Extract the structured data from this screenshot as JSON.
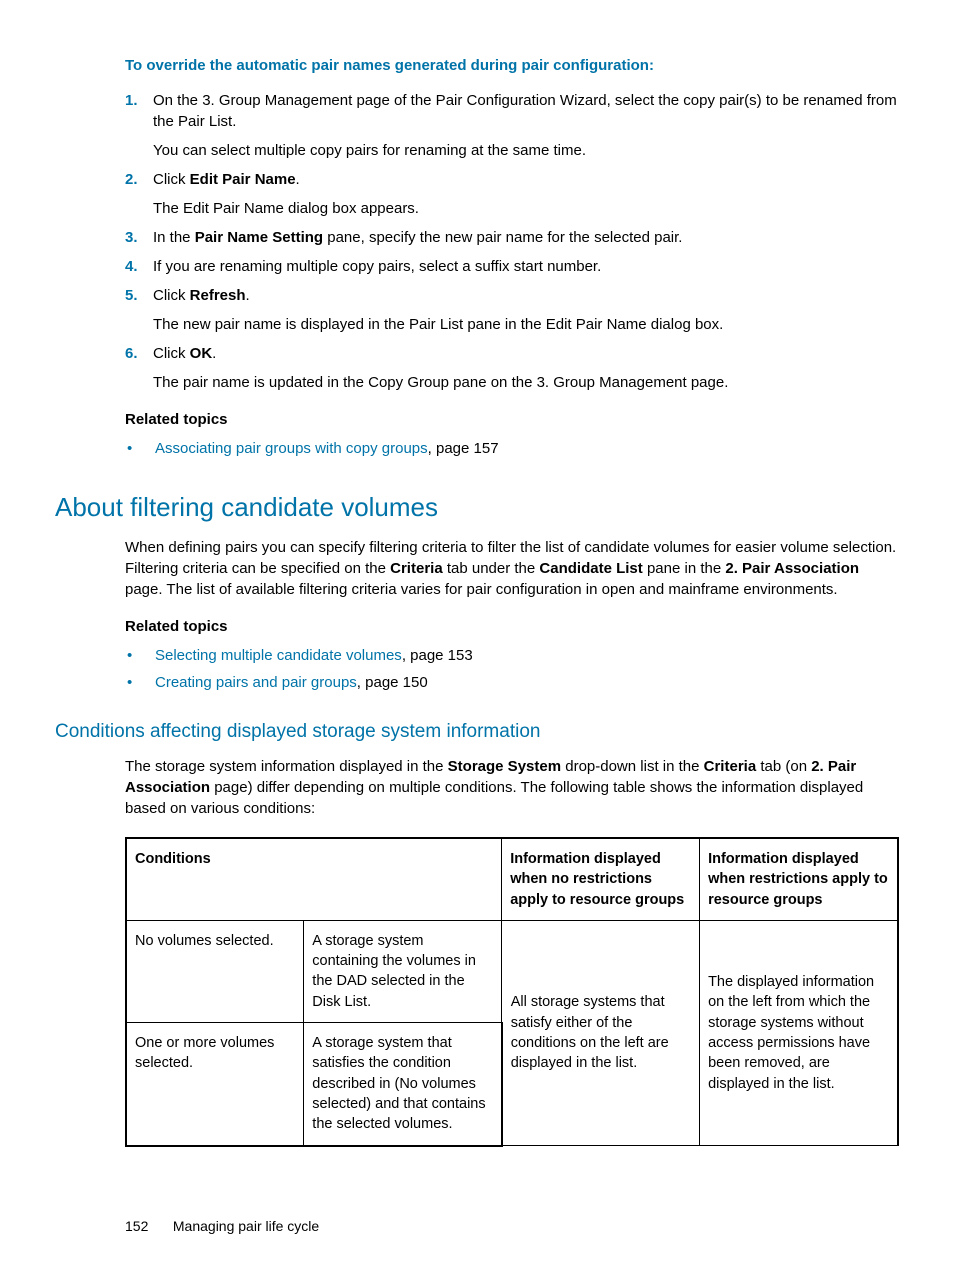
{
  "override": {
    "heading": "To override the automatic pair names generated during pair configuration:",
    "steps": [
      {
        "num": "1.",
        "p1": "On the 3. Group Management page of the Pair Configuration Wizard, select the copy pair(s) to be renamed from the Pair List.",
        "p2": "You can select multiple copy pairs for renaming at the same time."
      },
      {
        "num": "2.",
        "p1_pre": "Click ",
        "p1_b": "Edit Pair Name",
        "p1_post": ".",
        "p2": "The Edit Pair Name dialog box appears."
      },
      {
        "num": "3.",
        "p1_pre": "In the ",
        "p1_b": "Pair Name Setting",
        "p1_post": " pane, specify the new pair name  for the selected pair."
      },
      {
        "num": "4.",
        "p1": "If you are renaming multiple copy pairs, select a suffix start number."
      },
      {
        "num": "5.",
        "p1_pre": "Click ",
        "p1_b": "Refresh",
        "p1_post": ".",
        "p2": "The new pair name is displayed in the Pair List pane in the Edit Pair Name dialog box."
      },
      {
        "num": "6.",
        "p1_pre": "Click ",
        "p1_b": "OK",
        "p1_post": ".",
        "p2": "The pair name is updated in the Copy Group pane on the 3. Group Management page."
      }
    ],
    "related_heading": "Related topics",
    "related": [
      {
        "link": "Associating pair groups with copy groups",
        "tail": ", page 157"
      }
    ]
  },
  "about": {
    "heading": "About filtering candidate volumes",
    "para_pre": "When defining pairs you can specify filtering criteria to filter the list of candidate volumes for easier volume selection. Filtering criteria can be specified on the ",
    "b1": "Criteria",
    "mid1": " tab under the ",
    "b2": "Candidate List",
    "mid2": " pane in the ",
    "b3": "2. Pair Association",
    "tail": " page. The list of available filtering criteria varies for pair configuration in open and mainframe environments.",
    "related_heading": "Related topics",
    "related": [
      {
        "link": "Selecting multiple candidate volumes",
        "tail": ", page 153"
      },
      {
        "link": "Creating pairs and pair groups",
        "tail": ", page 150"
      }
    ]
  },
  "conditions": {
    "heading": "Conditions affecting displayed storage system information",
    "p_pre": "The storage system information displayed in the ",
    "b1": "Storage System",
    "mid1": " drop-down list in the ",
    "b2": "Criteria",
    "mid2": " tab (on ",
    "b3": "2. Pair Association",
    "tail": " page) differ depending on multiple conditions. The following table shows the information displayed based on various conditions:",
    "table": {
      "h1": "Conditions",
      "h2": "Information displayed when no restrictions apply to resource groups",
      "h3": "Information displayed when restrictions apply to resource groups",
      "r1c1": "No volumes selected.",
      "r1c2": "A storage system containing the volumes in the DAD selected in the Disk List.",
      "r2c1": "One or more volumes selected.",
      "r2c2": "A storage system that satisfies the condition described in (No volumes selected) and that contains the selected volumes.",
      "merged_norestrict": "All storage systems that satisfy either of the conditions on the left are displayed in the list.",
      "merged_restrict": "The displayed information on the left from which the storage systems without access permissions have been removed, are displayed in the list."
    }
  },
  "footer": {
    "page": "152",
    "title": "Managing pair life cycle"
  }
}
